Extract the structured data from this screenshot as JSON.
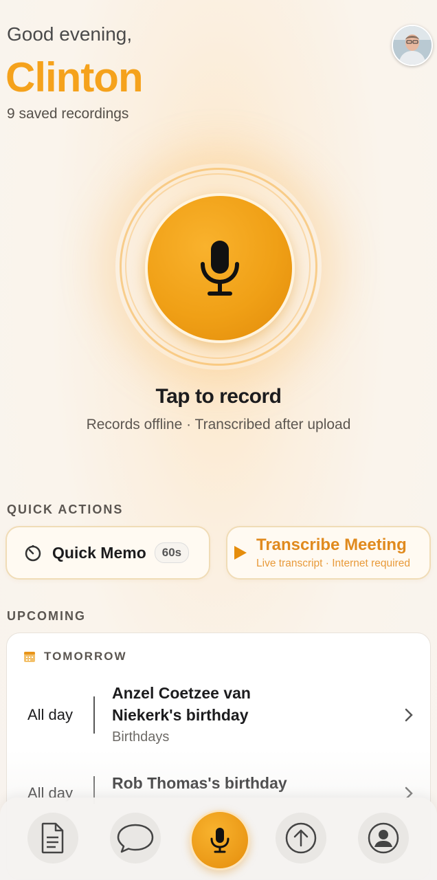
{
  "header": {
    "greeting": "Good evening,",
    "name": "Clinton",
    "saved_count": "9 saved recordings"
  },
  "record": {
    "title": "Tap to record",
    "subtitle": "Records offline · Transcribed after upload"
  },
  "quick_actions": {
    "label": "QUICK ACTIONS",
    "memo": {
      "title": "Quick Memo",
      "badge": "60s"
    },
    "meeting": {
      "title": "Transcribe Meeting",
      "subtitle": "Live transcript · Internet required"
    }
  },
  "upcoming": {
    "label": "UPCOMING",
    "day_label": "TOMORROW",
    "events": [
      {
        "time": "All day",
        "title": "Anzel Coetzee van Niekerk's birthday",
        "calendar": "Birthdays"
      },
      {
        "time": "All day",
        "title": "Rob Thomas's birthday",
        "calendar": ""
      }
    ]
  },
  "colors": {
    "accent": "#f5a21c",
    "accent_dark": "#e08a1e"
  },
  "tabbar": {
    "items": [
      "document-icon",
      "chat-bubble-icon",
      "microphone-icon",
      "upload-icon",
      "profile-icon"
    ]
  }
}
